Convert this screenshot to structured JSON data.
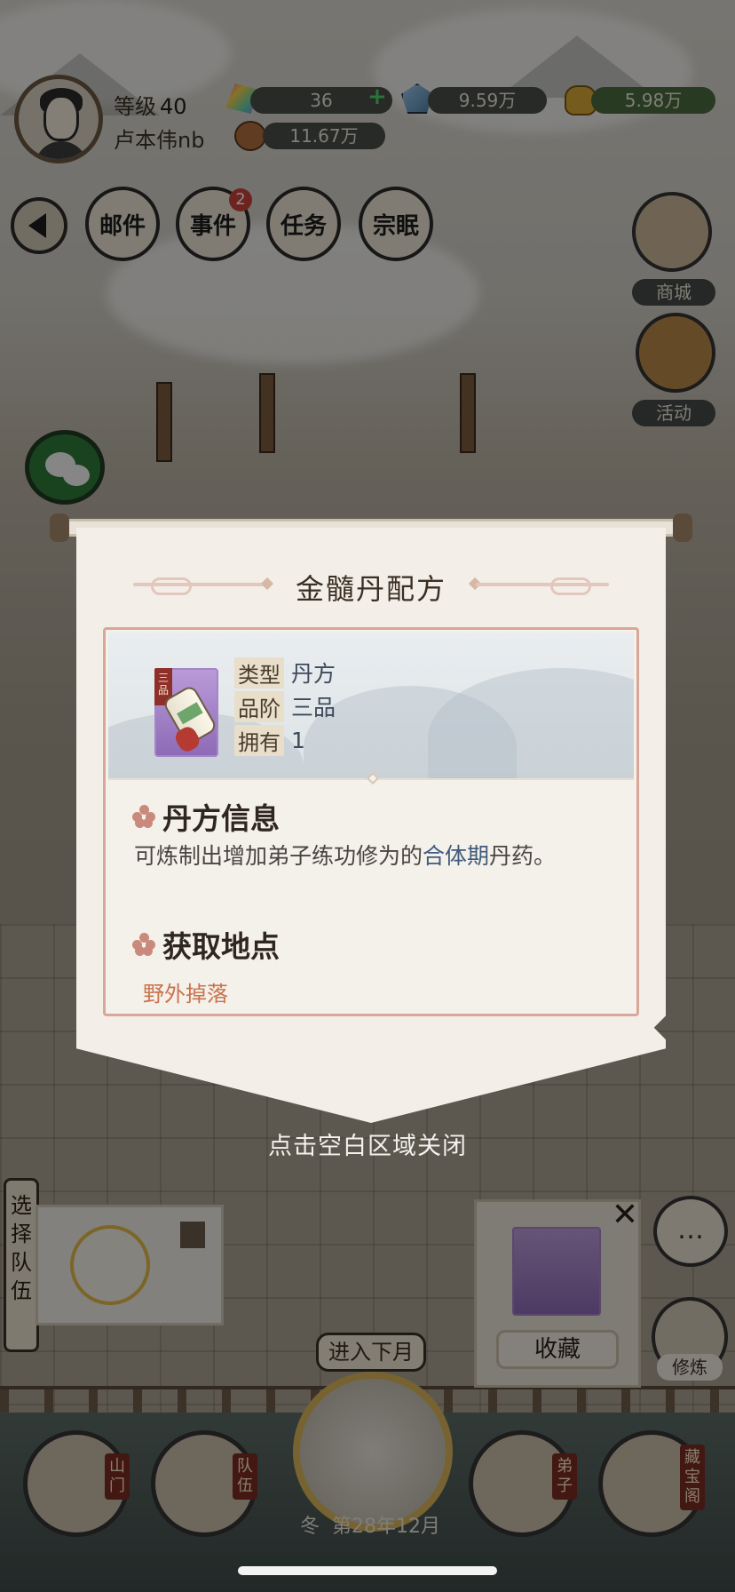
{
  "player": {
    "level_label": "等级",
    "level_value": "40",
    "name": "卢本伟nb"
  },
  "resources": {
    "jade": "36",
    "spirit_stone": "9.59万",
    "gold": "5.98万",
    "food": "11.67万"
  },
  "top_nav": {
    "mail": "邮件",
    "events": "事件",
    "events_badge": "2",
    "tasks": "任务",
    "sect": "宗眠"
  },
  "side_menu": {
    "shop": "商城",
    "activity": "活动"
  },
  "modal": {
    "title": "金髓丹配方",
    "item_grade_tag": "三品",
    "type_label": "类型",
    "type_value": "丹方",
    "grade_label": "品阶",
    "grade_value": "三品",
    "owned_label": "拥有",
    "owned_value": "1",
    "info_title": "丹方信息",
    "description_pre": "可炼制出增加弟子练功修为的",
    "description_highlight": "合体期",
    "description_post": "丹药。",
    "source_title": "获取地点",
    "source_value": "野外掉落"
  },
  "close_hint": "点击空白区域关闭",
  "bottom": {
    "select_team": "选择队伍",
    "collect": "收藏",
    "close_symbol": "✕",
    "cultivate": "修炼",
    "next_month": "进入下月",
    "season": "冬",
    "date": "第28年12月",
    "nav_gate": "山门",
    "nav_team": "队伍",
    "nav_disciple": "弟子",
    "nav_treasury": "藏宝阁"
  }
}
